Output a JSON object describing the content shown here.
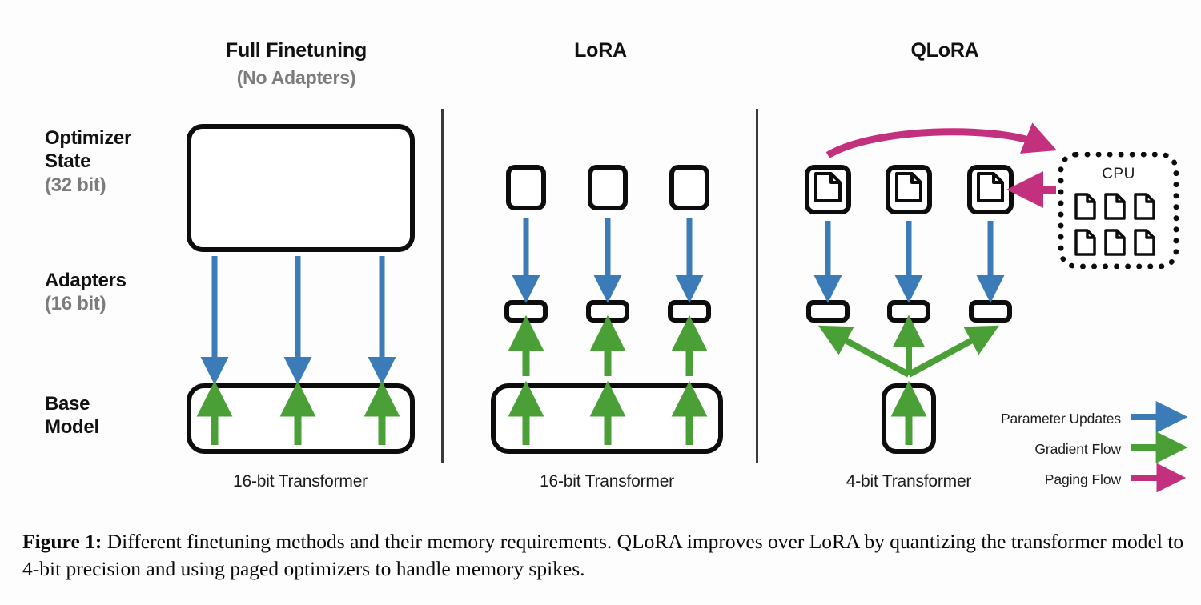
{
  "figure": {
    "caption_label": "Figure 1:",
    "caption_text": "Different finetuning methods and their memory requirements. QLoRA improves over LoRA by quantizing the transformer model to 4-bit precision and using paged optimizers to handle memory spikes."
  },
  "columns": [
    {
      "title": "Full Finetuning",
      "subtitle": "(No Adapters)",
      "footer": "16-bit Transformer"
    },
    {
      "title": "LoRA",
      "subtitle": "",
      "footer": "16-bit Transformer"
    },
    {
      "title": "QLoRA",
      "subtitle": "",
      "footer": "4-bit Transformer"
    }
  ],
  "rows": [
    {
      "name": "Optimizer State",
      "line1": "Optimizer",
      "line2": "State",
      "bits": "(32 bit)"
    },
    {
      "name": "Adapters",
      "line1": "Adapters",
      "line2": "",
      "bits": "(16 bit)"
    },
    {
      "name": "Base Model",
      "line1": "Base",
      "line2": "Model",
      "bits": ""
    }
  ],
  "cpu": {
    "label": "CPU",
    "page_count": 6
  },
  "legend": {
    "items": [
      {
        "label": "Parameter Updates",
        "color": "#3b7cb8"
      },
      {
        "label": "Gradient Flow",
        "color": "#4aa037"
      },
      {
        "label": "Paging Flow",
        "color": "#c3307d"
      }
    ]
  },
  "colors": {
    "parameter_updates": "#3b7cb8",
    "gradient_flow": "#4aa037",
    "paging_flow": "#c3307d",
    "outline": "#0d0d0d",
    "muted_text": "#7c7c7c",
    "background": "#fdfdfd"
  },
  "chart_data": {
    "type": "diagram",
    "title": "Different finetuning methods and their memory requirements",
    "panels": [
      {
        "name": "Full Finetuning",
        "optimizer_state": {
          "blocks": 1,
          "shape": "one-wide-box",
          "bits": 32
        },
        "adapters": {
          "blocks": 0
        },
        "base_model": {
          "blocks": 1,
          "shape": "wide-box",
          "precision": "16-bit"
        },
        "parameter_update_arrows": 3,
        "gradient_arrows": 3,
        "paging_arrows": 0
      },
      {
        "name": "LoRA",
        "optimizer_state": {
          "blocks": 3,
          "shape": "three-small-squares",
          "bits": 32
        },
        "adapters": {
          "blocks": 3,
          "shape": "three-small-pills",
          "bits": 16
        },
        "base_model": {
          "blocks": 1,
          "shape": "wide-box",
          "precision": "16-bit"
        },
        "parameter_update_arrows": 3,
        "gradient_arrows": 6,
        "paging_arrows": 0
      },
      {
        "name": "QLoRA",
        "optimizer_state": {
          "blocks": 3,
          "shape": "three-paged-squares",
          "bits": 32,
          "paged": true
        },
        "adapters": {
          "blocks": 3,
          "shape": "three-small-pills",
          "bits": 16
        },
        "base_model": {
          "blocks": 1,
          "shape": "narrow-tall-box",
          "precision": "4-bit"
        },
        "parameter_update_arrows": 3,
        "gradient_arrows": 4,
        "paging_arrows": 2,
        "cpu_offload": {
          "pages": 6
        }
      }
    ]
  }
}
